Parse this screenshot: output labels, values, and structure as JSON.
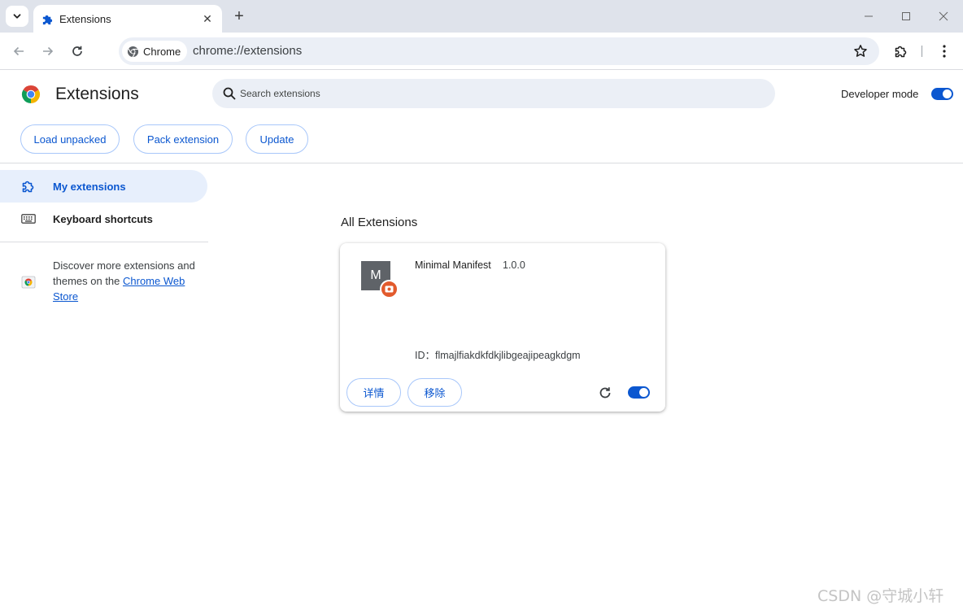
{
  "tab": {
    "title": "Extensions",
    "icon": "puzzle-icon"
  },
  "omnibox": {
    "chip_label": "Chrome",
    "url": "chrome://extensions"
  },
  "header": {
    "title": "Extensions",
    "search_placeholder": "Search extensions",
    "developer_mode_label": "Developer mode",
    "developer_mode_on": true
  },
  "actions": {
    "load_unpacked": "Load unpacked",
    "pack_extension": "Pack extension",
    "update": "Update"
  },
  "sidebar": {
    "items": [
      {
        "label": "My extensions",
        "icon": "puzzle-icon",
        "active": true
      },
      {
        "label": "Keyboard shortcuts",
        "icon": "keyboard-icon",
        "active": false
      }
    ],
    "store_text": "Discover more extensions and themes on the ",
    "store_link": "Chrome Web Store"
  },
  "main": {
    "section_title": "All Extensions",
    "extension": {
      "icon_letter": "M",
      "name": "Minimal Manifest",
      "version": "1.0.0",
      "id_text": "ID：flmajlfiakdkfdkjlibgeajipeagkdgm",
      "details_label": "详情",
      "remove_label": "移除",
      "enabled": true
    }
  },
  "watermark": "CSDN @守城小轩",
  "colors": {
    "accent": "#0b57d0",
    "badge": "#e25a2c",
    "tabstrip": "#dfe3eb",
    "omnibox": "#ebeff6"
  }
}
